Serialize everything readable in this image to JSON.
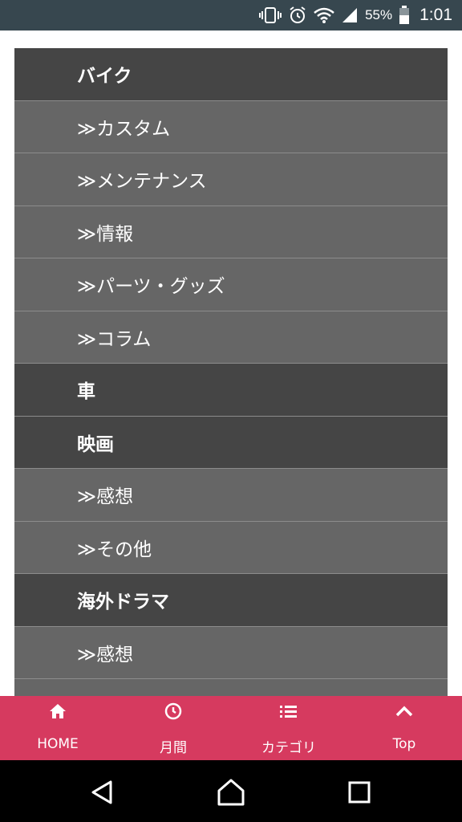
{
  "status_bar": {
    "battery_percent": "55%",
    "time": "1:01",
    "icons": [
      "vibrate-icon",
      "alarm-icon",
      "wifi-icon",
      "signal-icon",
      "battery-icon"
    ]
  },
  "categories": [
    {
      "label": "バイク",
      "level": "parent"
    },
    {
      "label": "≫カスタム",
      "level": "child"
    },
    {
      "label": "≫メンテナンス",
      "level": "child"
    },
    {
      "label": "≫情報",
      "level": "child"
    },
    {
      "label": "≫パーツ・グッズ",
      "level": "child"
    },
    {
      "label": "≫コラム",
      "level": "child"
    },
    {
      "label": "車",
      "level": "parent"
    },
    {
      "label": "映画",
      "level": "parent"
    },
    {
      "label": "≫感想",
      "level": "child"
    },
    {
      "label": "≫その他",
      "level": "child"
    },
    {
      "label": "海外ドラマ",
      "level": "parent"
    },
    {
      "label": "≫感想",
      "level": "child"
    },
    {
      "label": "",
      "level": "child"
    }
  ],
  "bottom_nav": {
    "items": [
      {
        "label": "HOME",
        "icon": "home-icon"
      },
      {
        "label": "月間",
        "icon": "clock-icon"
      },
      {
        "label": "カテゴリ",
        "icon": "list-icon"
      },
      {
        "label": "Top",
        "icon": "chevron-up-icon"
      }
    ],
    "color": "#d63a5f"
  },
  "android_nav": {
    "icons": [
      "back-icon",
      "home-icon",
      "recents-icon"
    ]
  }
}
